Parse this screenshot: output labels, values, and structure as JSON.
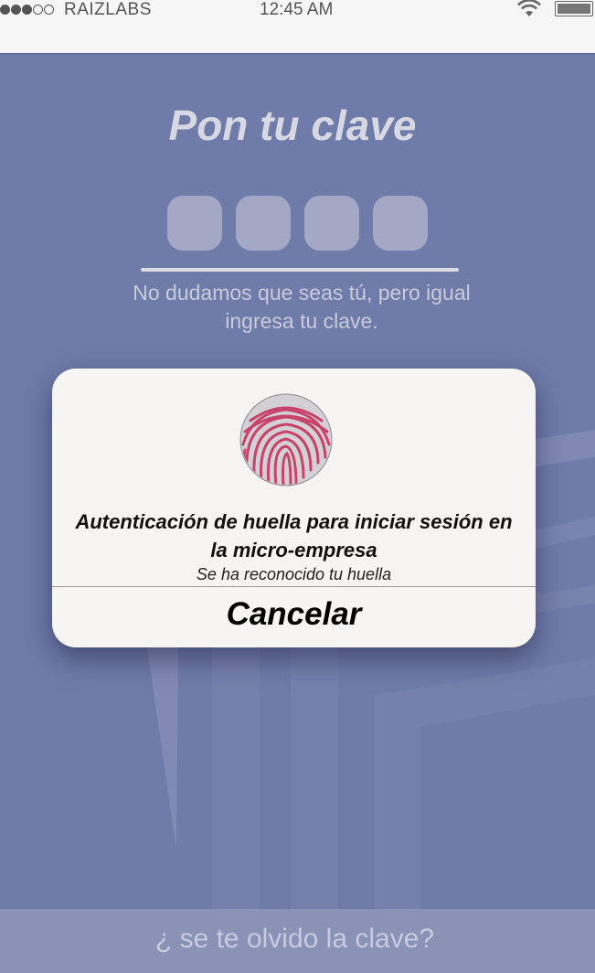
{
  "status_bar": {
    "carrier": "RAIZLABS",
    "time": "12:45 AM",
    "signal_strength": "3 of 5",
    "icons": [
      "signal-dots-icon",
      "wifi-icon",
      "battery-icon"
    ]
  },
  "login": {
    "title": "Pon tu clave",
    "pin_slots": 4,
    "subtitle": "No dudamos que seas tú, pero igual ingresa tu clave."
  },
  "modal": {
    "icon": "fingerprint-icon",
    "title": "Autenticación de huella para iniciar sesión en la micro-empresa",
    "status": "Se ha reconocido tu huella",
    "cancel_label": "Cancelar"
  },
  "footer": {
    "forgot_label": "¿ se te olvido la clave?"
  },
  "colors": {
    "background": "#6f7ba8",
    "modal": "#f6f5f4",
    "fingerprint_ring": "#cc5a7c",
    "status_bar": "#f6f6f6"
  }
}
